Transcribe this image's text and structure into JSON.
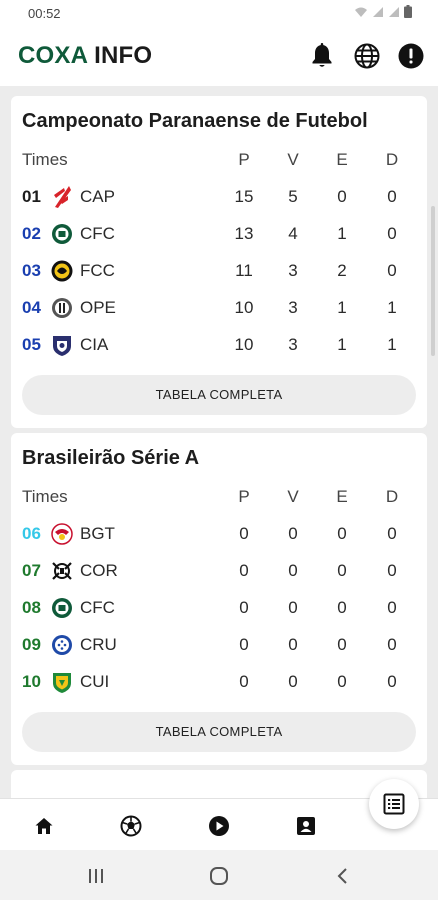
{
  "status_bar": {
    "time": "00:52"
  },
  "app": {
    "logo_part1": "COXA",
    "logo_part2": "INFO"
  },
  "colors": {
    "brand_green": "#0f5a3a",
    "pos_libertadores": "#1a3fb0",
    "pos_sulamericana": "#35c8e8",
    "pos_green": "#1f7a2e",
    "card_bg": "#ffffff",
    "page_bg": "#ececec"
  },
  "cards": [
    {
      "title": "Campeonato Paranaense de Futebol",
      "columns": {
        "teams": "Times",
        "p": "P",
        "v": "V",
        "e": "E",
        "d": "D"
      },
      "rows": [
        {
          "pos": "01",
          "team": "CAP",
          "crest": "athletico-crest-icon",
          "p": "15",
          "v": "5",
          "e": "0",
          "d": "0"
        },
        {
          "pos": "02",
          "team": "CFC",
          "crest": "coritiba-crest-icon",
          "p": "13",
          "v": "4",
          "e": "1",
          "d": "0"
        },
        {
          "pos": "03",
          "team": "FCC",
          "crest": "fc-cascavel-crest-icon",
          "p": "11",
          "v": "3",
          "e": "2",
          "d": "0"
        },
        {
          "pos": "04",
          "team": "OPE",
          "crest": "operario-crest-icon",
          "p": "10",
          "v": "3",
          "e": "1",
          "d": "1"
        },
        {
          "pos": "05",
          "team": "CIA",
          "crest": "cianorte-crest-icon",
          "p": "10",
          "v": "3",
          "e": "1",
          "d": "1"
        }
      ],
      "button": "TABELA COMPLETA"
    },
    {
      "title": "Brasileirão Série A",
      "columns": {
        "teams": "Times",
        "p": "P",
        "v": "V",
        "e": "E",
        "d": "D"
      },
      "rows": [
        {
          "pos": "06",
          "team": "BGT",
          "crest": "bragantino-crest-icon",
          "p": "0",
          "v": "0",
          "e": "0",
          "d": "0"
        },
        {
          "pos": "07",
          "team": "COR",
          "crest": "corinthians-crest-icon",
          "p": "0",
          "v": "0",
          "e": "0",
          "d": "0"
        },
        {
          "pos": "08",
          "team": "CFC",
          "crest": "coritiba-crest-icon",
          "p": "0",
          "v": "0",
          "e": "0",
          "d": "0"
        },
        {
          "pos": "09",
          "team": "CRU",
          "crest": "cruzeiro-crest-icon",
          "p": "0",
          "v": "0",
          "e": "0",
          "d": "0"
        },
        {
          "pos": "10",
          "team": "CUI",
          "crest": "cuiaba-crest-icon",
          "p": "0",
          "v": "0",
          "e": "0",
          "d": "0"
        }
      ],
      "button": "TABELA COMPLETA"
    }
  ],
  "header_icons": [
    "bell-icon",
    "globe-icon",
    "alert-icon"
  ],
  "bottom_nav": [
    "home-icon",
    "soccer-ball-icon",
    "play-icon",
    "contact-card-icon"
  ],
  "fab_icon": "list-alt-icon",
  "system_nav": [
    "recents-icon",
    "home-circle-icon",
    "back-icon"
  ]
}
